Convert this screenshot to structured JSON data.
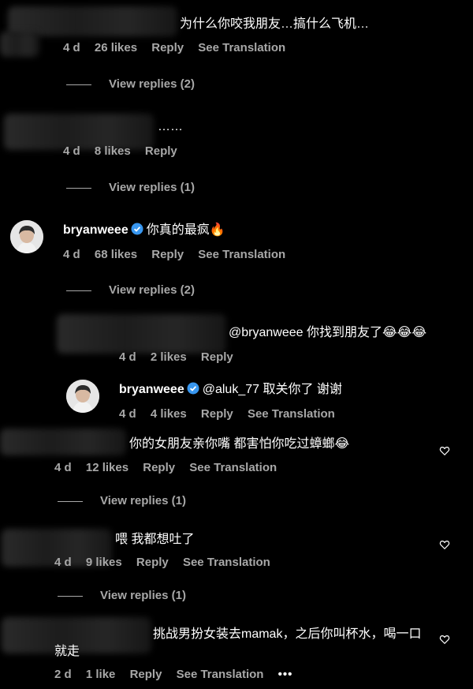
{
  "comments": [
    {
      "text": "为什么你咬我朋友…搞什么飞机…",
      "time": "4 d",
      "likes": "26 likes",
      "reply": "Reply",
      "translate": "See Translation",
      "view_replies": "View replies (2)"
    },
    {
      "text": "……",
      "time": "4 d",
      "likes": "8 likes",
      "reply": "Reply",
      "view_replies": "View replies (1)"
    },
    {
      "user": "bryanweee",
      "text": "你真的最疯🔥",
      "time": "4 d",
      "likes": "68 likes",
      "reply": "Reply",
      "translate": "See Translation",
      "view_replies": "View replies (2)"
    },
    {
      "text": "@bryanweee 你找到朋友了😂😂😂",
      "time": "4 d",
      "likes": "2 likes",
      "reply": "Reply"
    },
    {
      "user": "bryanweee",
      "text": "@aluk_77 取关你了 谢谢",
      "time": "4 d",
      "likes": "4 likes",
      "reply": "Reply",
      "translate": "See Translation"
    },
    {
      "text": "你的女朋友亲你嘴 都害怕你吃过蟑螂😂",
      "time": "4 d",
      "likes": "12 likes",
      "reply": "Reply",
      "translate": "See Translation",
      "view_replies": "View replies (1)"
    },
    {
      "text": "喂 我都想吐了",
      "time": "4 d",
      "likes": "9 likes",
      "reply": "Reply",
      "translate": "See Translation",
      "view_replies": "View replies (1)"
    },
    {
      "text": "挑战男扮女装去mamak，之后你叫杯水，喝一口就走",
      "time": "2 d",
      "likes": "1 like",
      "reply": "Reply",
      "translate": "See Translation",
      "more": "•••"
    }
  ],
  "icons": {
    "verified": "verified-badge-icon",
    "heart": "heart-outline-icon",
    "more": "more-icon"
  },
  "colors": {
    "background": "#000000",
    "meta": "#a8a8a8",
    "verified": "#3897f0"
  }
}
